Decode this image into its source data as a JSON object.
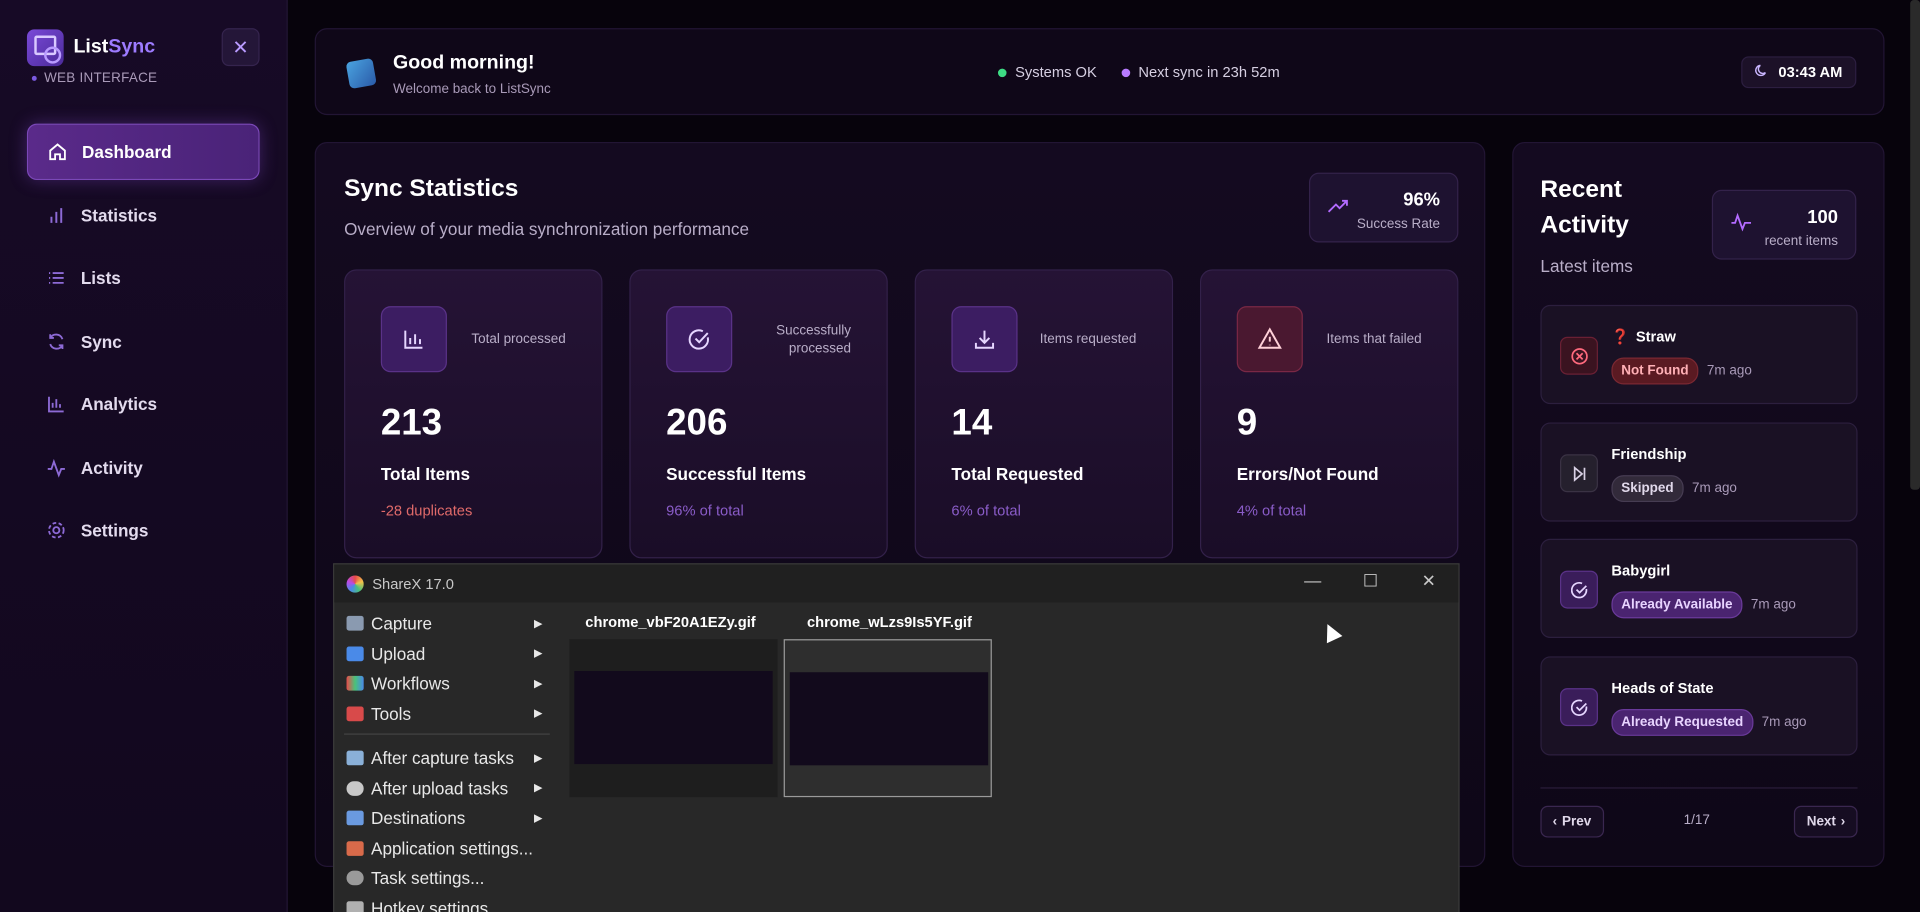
{
  "sidebar": {
    "brand_main": "List",
    "brand_accent": "Sync",
    "brand_sub": "WEB INTERFACE",
    "close_glyph": "✕",
    "items": [
      {
        "label": "Dashboard",
        "icon": "home-icon",
        "active": true
      },
      {
        "label": "Statistics",
        "icon": "bar-chart-icon",
        "active": false
      },
      {
        "label": "Lists",
        "icon": "list-icon",
        "active": false
      },
      {
        "label": "Sync",
        "icon": "refresh-icon",
        "active": false
      },
      {
        "label": "Analytics",
        "icon": "analytics-icon",
        "active": false
      },
      {
        "label": "Activity",
        "icon": "activity-icon",
        "active": false
      },
      {
        "label": "Settings",
        "icon": "gear-icon",
        "active": false
      }
    ]
  },
  "header": {
    "title": "Good morning!",
    "subtitle": "Welcome back to ListSync",
    "status_ok": "Systems OK",
    "next_sync": "Next sync in 23h 52m",
    "time": "03:43 AM"
  },
  "stats": {
    "title": "Sync Statistics",
    "subtitle": "Overview of your media synchronization performance",
    "success_rate": "96%",
    "success_label": "Success Rate",
    "cards": [
      {
        "desc": "Total processed",
        "value": "213",
        "label": "Total Items",
        "note": "-28 duplicates",
        "icon": "bar-chart-icon"
      },
      {
        "desc": "Successfully processed",
        "value": "206",
        "label": "Successful Items",
        "note": "96% of total",
        "icon": "check-circle-icon"
      },
      {
        "desc": "Items requested",
        "value": "14",
        "label": "Total Requested",
        "note": "6% of total",
        "icon": "download-icon"
      },
      {
        "desc": "Items that failed",
        "value": "9",
        "label": "Errors/Not Found",
        "note": "4% of total",
        "icon": "warning-icon"
      }
    ]
  },
  "activity": {
    "title": "Recent Activity",
    "subtitle": "Latest items",
    "count": "100",
    "count_label": "recent items",
    "items": [
      {
        "name": "Straw",
        "prefix": "❓",
        "badge": "Not Found",
        "time": "7m ago",
        "icon": "x-circle-icon"
      },
      {
        "name": "Friendship",
        "prefix": "",
        "badge": "Skipped",
        "time": "7m ago",
        "icon": "skip-icon"
      },
      {
        "name": "Babygirl",
        "prefix": "",
        "badge": "Already Available",
        "time": "7m ago",
        "icon": "check-circle-icon"
      },
      {
        "name": "Heads of State",
        "prefix": "",
        "badge": "Already Requested",
        "time": "7m ago",
        "icon": "check-circle-icon"
      }
    ],
    "prev": "Prev",
    "next": "Next",
    "page": "1/17"
  },
  "sharex": {
    "title": "ShareX 17.0",
    "menu": [
      {
        "label": "Capture",
        "submenu": true
      },
      {
        "label": "Upload",
        "submenu": true
      },
      {
        "label": "Workflows",
        "submenu": true
      },
      {
        "label": "Tools",
        "submenu": true
      },
      {
        "label": "After capture tasks",
        "submenu": true
      },
      {
        "label": "After upload tasks",
        "submenu": true
      },
      {
        "label": "Destinations",
        "submenu": true
      },
      {
        "label": "Application settings...",
        "submenu": false
      },
      {
        "label": "Task settings...",
        "submenu": false
      },
      {
        "label": "Hotkey settings...",
        "submenu": false
      }
    ],
    "files": [
      "chrome_vbF20A1EZy.gif",
      "chrome_wLzs9Is5YF.gif"
    ]
  },
  "colors": {
    "accent": "#9d7bff",
    "success": "#3ddc84",
    "error": "#e06a6a"
  }
}
